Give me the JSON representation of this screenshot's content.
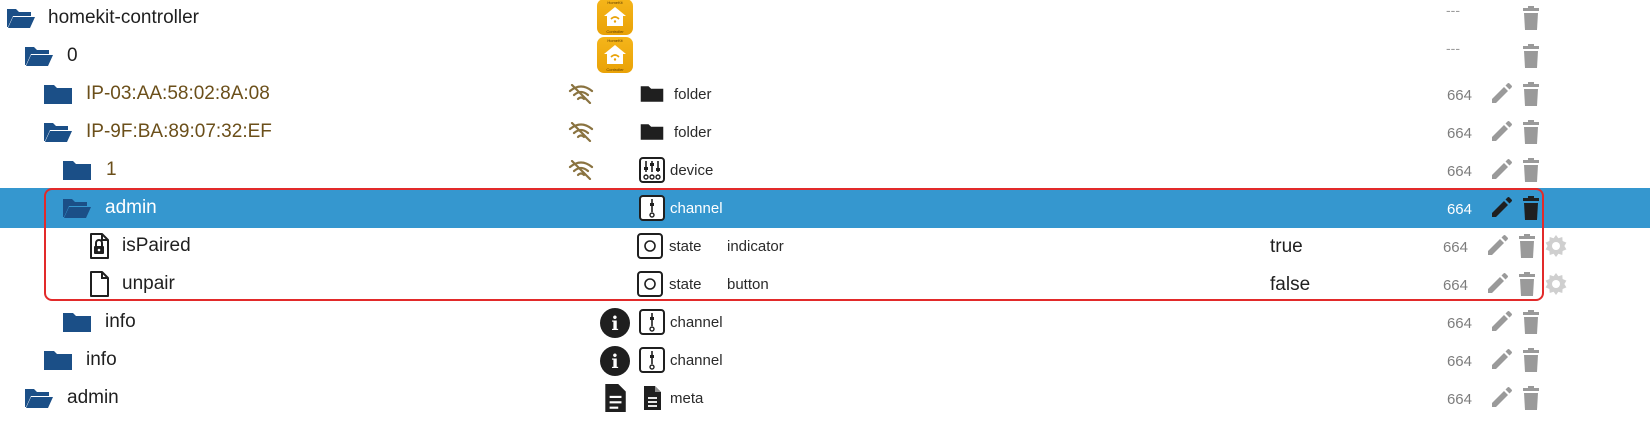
{
  "tree": {
    "rows": [
      {
        "name": "homekit-controller",
        "acl": "---"
      },
      {
        "name": "0",
        "acl": "---"
      },
      {
        "name": "IP-03:AA:58:02:8A:08",
        "type": "folder",
        "acl": "664"
      },
      {
        "name": "IP-9F:BA:89:07:32:EF",
        "type": "folder",
        "acl": "664"
      },
      {
        "name": "1",
        "type": "device",
        "acl": "664"
      },
      {
        "name": "admin",
        "type": "channel",
        "acl": "664"
      },
      {
        "name": "isPaired",
        "type": "state",
        "role": "indicator",
        "value": "true",
        "acl": "664"
      },
      {
        "name": "unpair",
        "type": "state",
        "role": "button",
        "value": "false",
        "acl": "664"
      },
      {
        "name": "info",
        "type": "channel",
        "acl": "664"
      },
      {
        "name": "info",
        "type": "channel",
        "acl": "664"
      },
      {
        "name": "admin",
        "type": "meta",
        "acl": "664"
      }
    ]
  },
  "logo": {
    "lines": [
      "HomeKit",
      "Controller"
    ]
  },
  "icons": {
    "folder_open": "folder-open-icon",
    "folder_closed": "folder-closed-icon",
    "lock_file": "lock-file-icon",
    "file": "file-icon",
    "wifi_off": "wifi-off-icon",
    "info": "info-icon",
    "edit": "pencil-icon",
    "delete": "trash-icon",
    "settings": "gear-icon"
  },
  "colors": {
    "selected_row": "#3597cf",
    "folder": "#1b4f87",
    "highlight_border": "#e22a2a",
    "adapter_text": "#6b4f1a"
  }
}
